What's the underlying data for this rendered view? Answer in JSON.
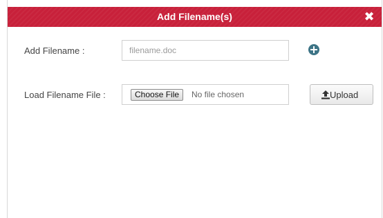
{
  "dialog": {
    "title": "Add Filename(s)",
    "close_icon": "close-icon",
    "close_symbol": "✖"
  },
  "add_filename": {
    "label": "Add Filename :",
    "placeholder": "filename.doc",
    "add_icon": "plus-circle-icon"
  },
  "load_file": {
    "label": "Load Filename File :",
    "choose_button": "Choose File",
    "status": "No file chosen",
    "upload_button": "Upload",
    "upload_icon": "upload-icon"
  },
  "colors": {
    "titlebar": "#c8203a",
    "add_icon": "#3d7486"
  }
}
